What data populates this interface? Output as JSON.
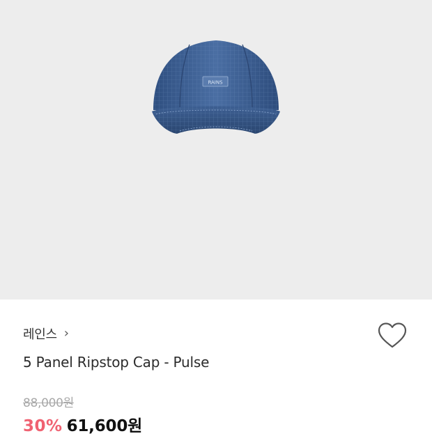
{
  "product": {
    "brand": "레인스",
    "brand_chevron": "›",
    "name": "5 Panel Ripstop Cap - Pulse",
    "original_price": "88,000원",
    "discount_rate": "30%",
    "sale_price": "61,600원",
    "cap_logo_text": "RAINS"
  },
  "icons": {
    "wishlist": "heart-outline-icon",
    "brand_link": "chevron-right-icon"
  },
  "colors": {
    "discount": "#f06272",
    "image_bg": "#ededed",
    "cap": "#3e5f8f"
  }
}
